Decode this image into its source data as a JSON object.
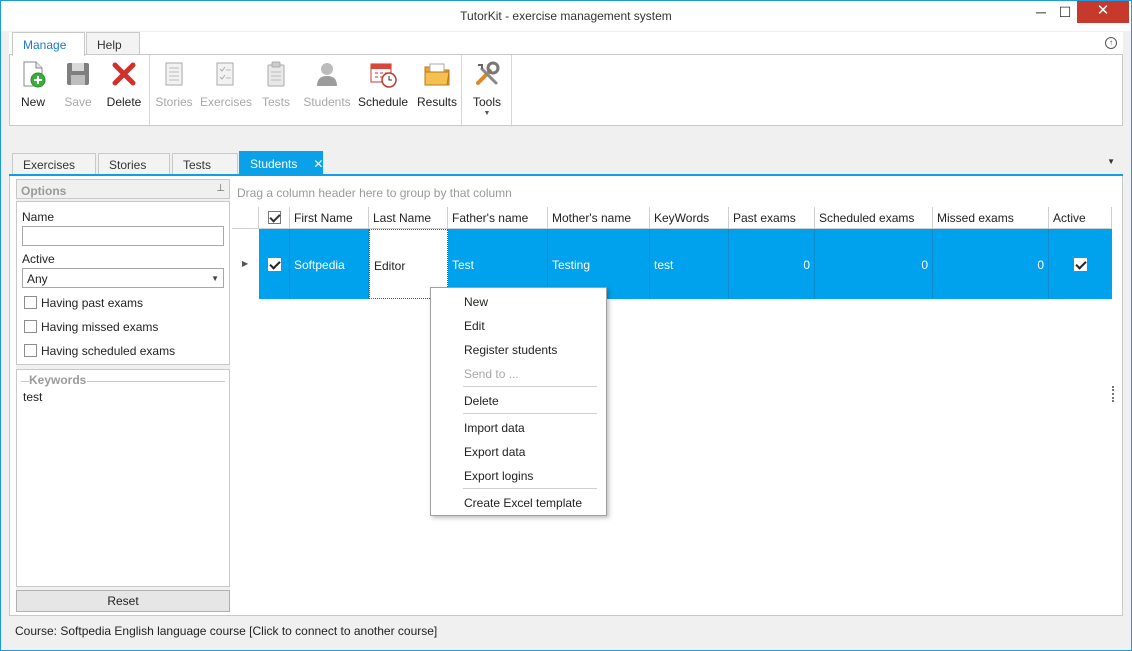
{
  "window": {
    "title": "TutorKit - exercise management system",
    "minimize": "─",
    "maximize": "☐",
    "close": "✕"
  },
  "ribbon": {
    "tabs": [
      {
        "label": "Manage"
      },
      {
        "label": "Help"
      }
    ],
    "collapse_glyph": "↑",
    "buttons": {
      "new": "New",
      "save": "Save",
      "delete": "Delete",
      "stories": "Stories",
      "exercises": "Exercises",
      "tests": "Tests",
      "students": "Students",
      "schedule": "Schedule",
      "results": "Results",
      "tools": "Tools"
    },
    "dropdown_glyph": "▼"
  },
  "doc_tabs": {
    "items": [
      {
        "label": "Exercises"
      },
      {
        "label": "Stories"
      },
      {
        "label": "Tests"
      },
      {
        "label": "Students"
      }
    ],
    "close_glyph": "✕",
    "overflow_glyph": "▼"
  },
  "options": {
    "title": "Options",
    "pin_glyph": "⊥",
    "name_label": "Name",
    "name_value": "",
    "active_label": "Active",
    "active_value": "Any",
    "checkboxes": [
      {
        "label": "Having past exams",
        "checked": false
      },
      {
        "label": "Having missed exams",
        "checked": false
      },
      {
        "label": "Having scheduled exams",
        "checked": false
      }
    ],
    "keywords_title": "Keywords",
    "keywords_value": "test",
    "reset_label": "Reset"
  },
  "grid": {
    "group_hint": "Drag a column header here to group by that column",
    "columns": [
      "First Name",
      "Last Name",
      "Father's name",
      "Mother's name",
      "KeyWords",
      "Past exams",
      "Scheduled exams",
      "Missed exams",
      "Active"
    ],
    "rows": [
      {
        "first_name": "Softpedia",
        "last_name": "Editor",
        "fathers_name": "Test",
        "mothers_name": "Testing",
        "keywords": "test",
        "past_exams": "0",
        "scheduled_exams": "0",
        "missed_exams": "0",
        "selected": true,
        "active": true
      }
    ],
    "row_indicator_glyph": "▶"
  },
  "context_menu": {
    "items": [
      {
        "label": "New",
        "enabled": true
      },
      {
        "label": "Edit",
        "enabled": true
      },
      {
        "label": "Register students",
        "enabled": true
      },
      {
        "label": "Send to ...",
        "enabled": false
      },
      {
        "label": "Delete",
        "enabled": true
      },
      {
        "label": "Import data",
        "enabled": true
      },
      {
        "label": "Export data",
        "enabled": true
      },
      {
        "label": "Export logins",
        "enabled": true
      },
      {
        "label": "Create Excel template",
        "enabled": true
      }
    ]
  },
  "statusbar": {
    "text": "Course: Softpedia English language course [Click to connect to another course]"
  },
  "colors": {
    "accent": "#0aa1e8",
    "selection": "#00a2ed",
    "close_button": "#c7392b"
  }
}
